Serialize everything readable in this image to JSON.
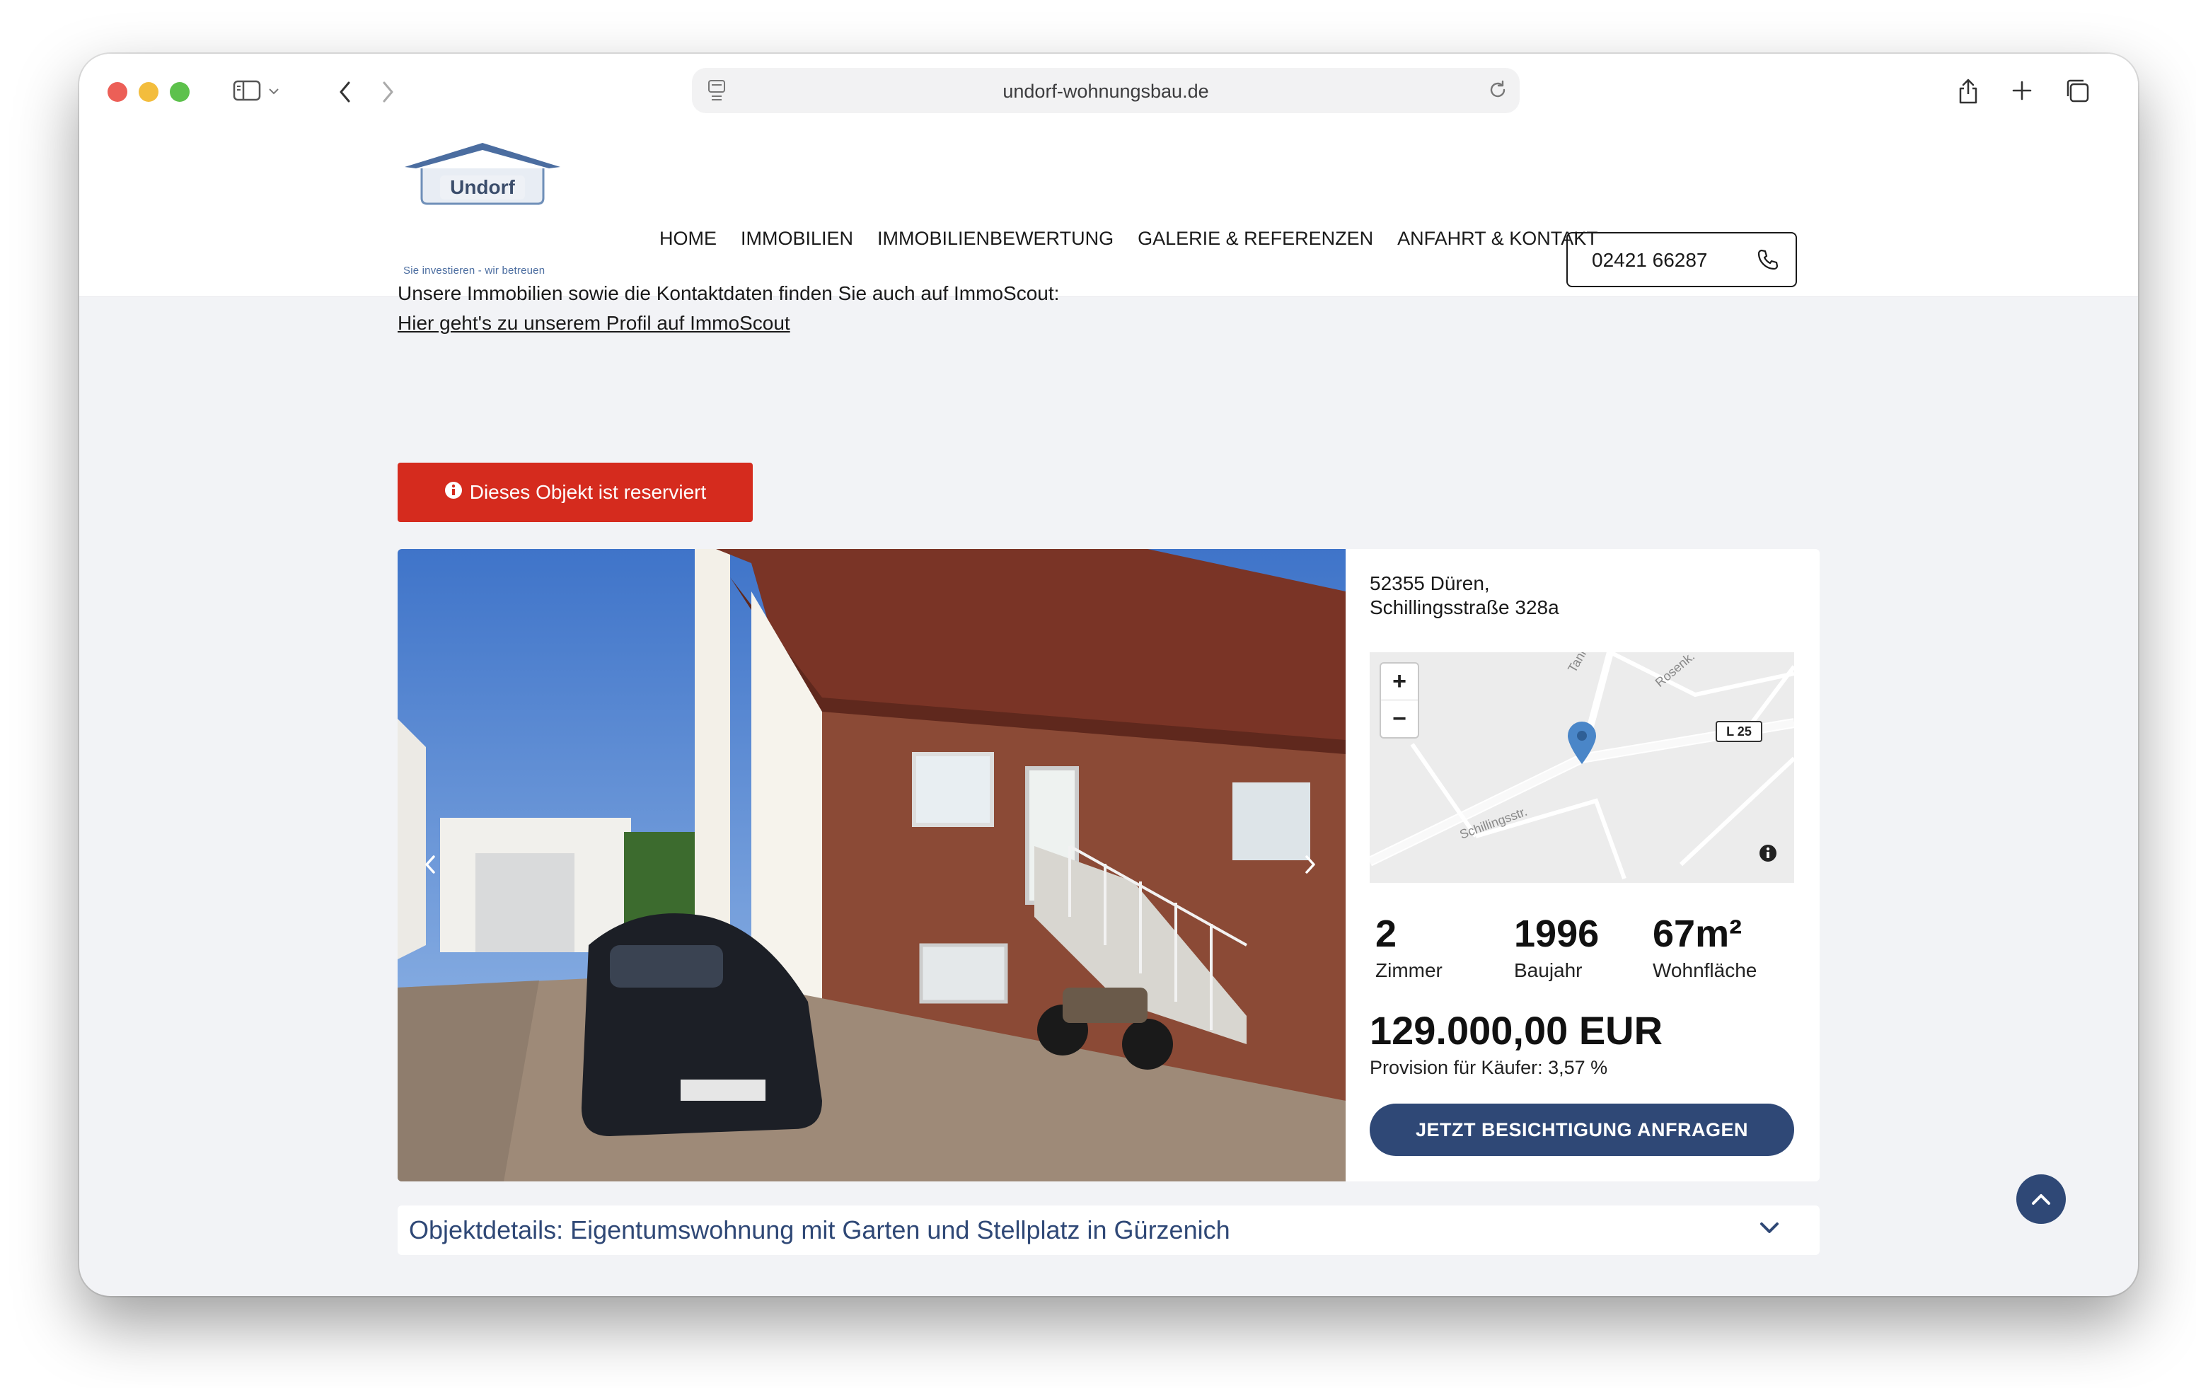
{
  "browser": {
    "url": "undorf-wohnungsbau.de"
  },
  "header": {
    "logo_text": "Undorf",
    "logo_tagline": "Sie investieren - wir betreuen",
    "nav": [
      "HOME",
      "IMMOBILIEN",
      "IMMOBILIENBEWERTUNG",
      "GALERIE & REFERENZEN",
      "ANFAHRT & KONTAKT"
    ],
    "phone": "02421 66287"
  },
  "intro": {
    "text": "Unsere Immobilien sowie die Kontaktdaten finden Sie auch auf ImmoScout:",
    "link": "Hier geht's zu unserem Profil auf ImmoScout"
  },
  "badge": {
    "label": "Dieses Objekt ist reserviert",
    "color": "#d52b1e"
  },
  "property": {
    "address_line1": "52355 Düren,",
    "address_line2": "Schillingsstraße 328a",
    "map": {
      "zoom_in": "+",
      "zoom_out": "−",
      "labels": [
        "Schillingsstr.",
        "Tann.",
        "Rosenk.",
        "L 25"
      ]
    },
    "stats": [
      {
        "value": "2",
        "label": "Zimmer"
      },
      {
        "value": "1996",
        "label": "Baujahr"
      },
      {
        "value": "67m²",
        "label": "Wohnfläche"
      }
    ],
    "price": "129.000,00 EUR",
    "provision": "Provision für Käufer: 3,57 %",
    "cta": "JETZT BESICHTIGUNG ANFRAGEN"
  },
  "details": {
    "title": "Objektdetails: Eigentumswohnung mit Garten und Stellplatz in Gürzenich"
  },
  "colors": {
    "brand": "#2f4876",
    "reserved": "#d52b1e",
    "background": "#f2f3f6"
  }
}
